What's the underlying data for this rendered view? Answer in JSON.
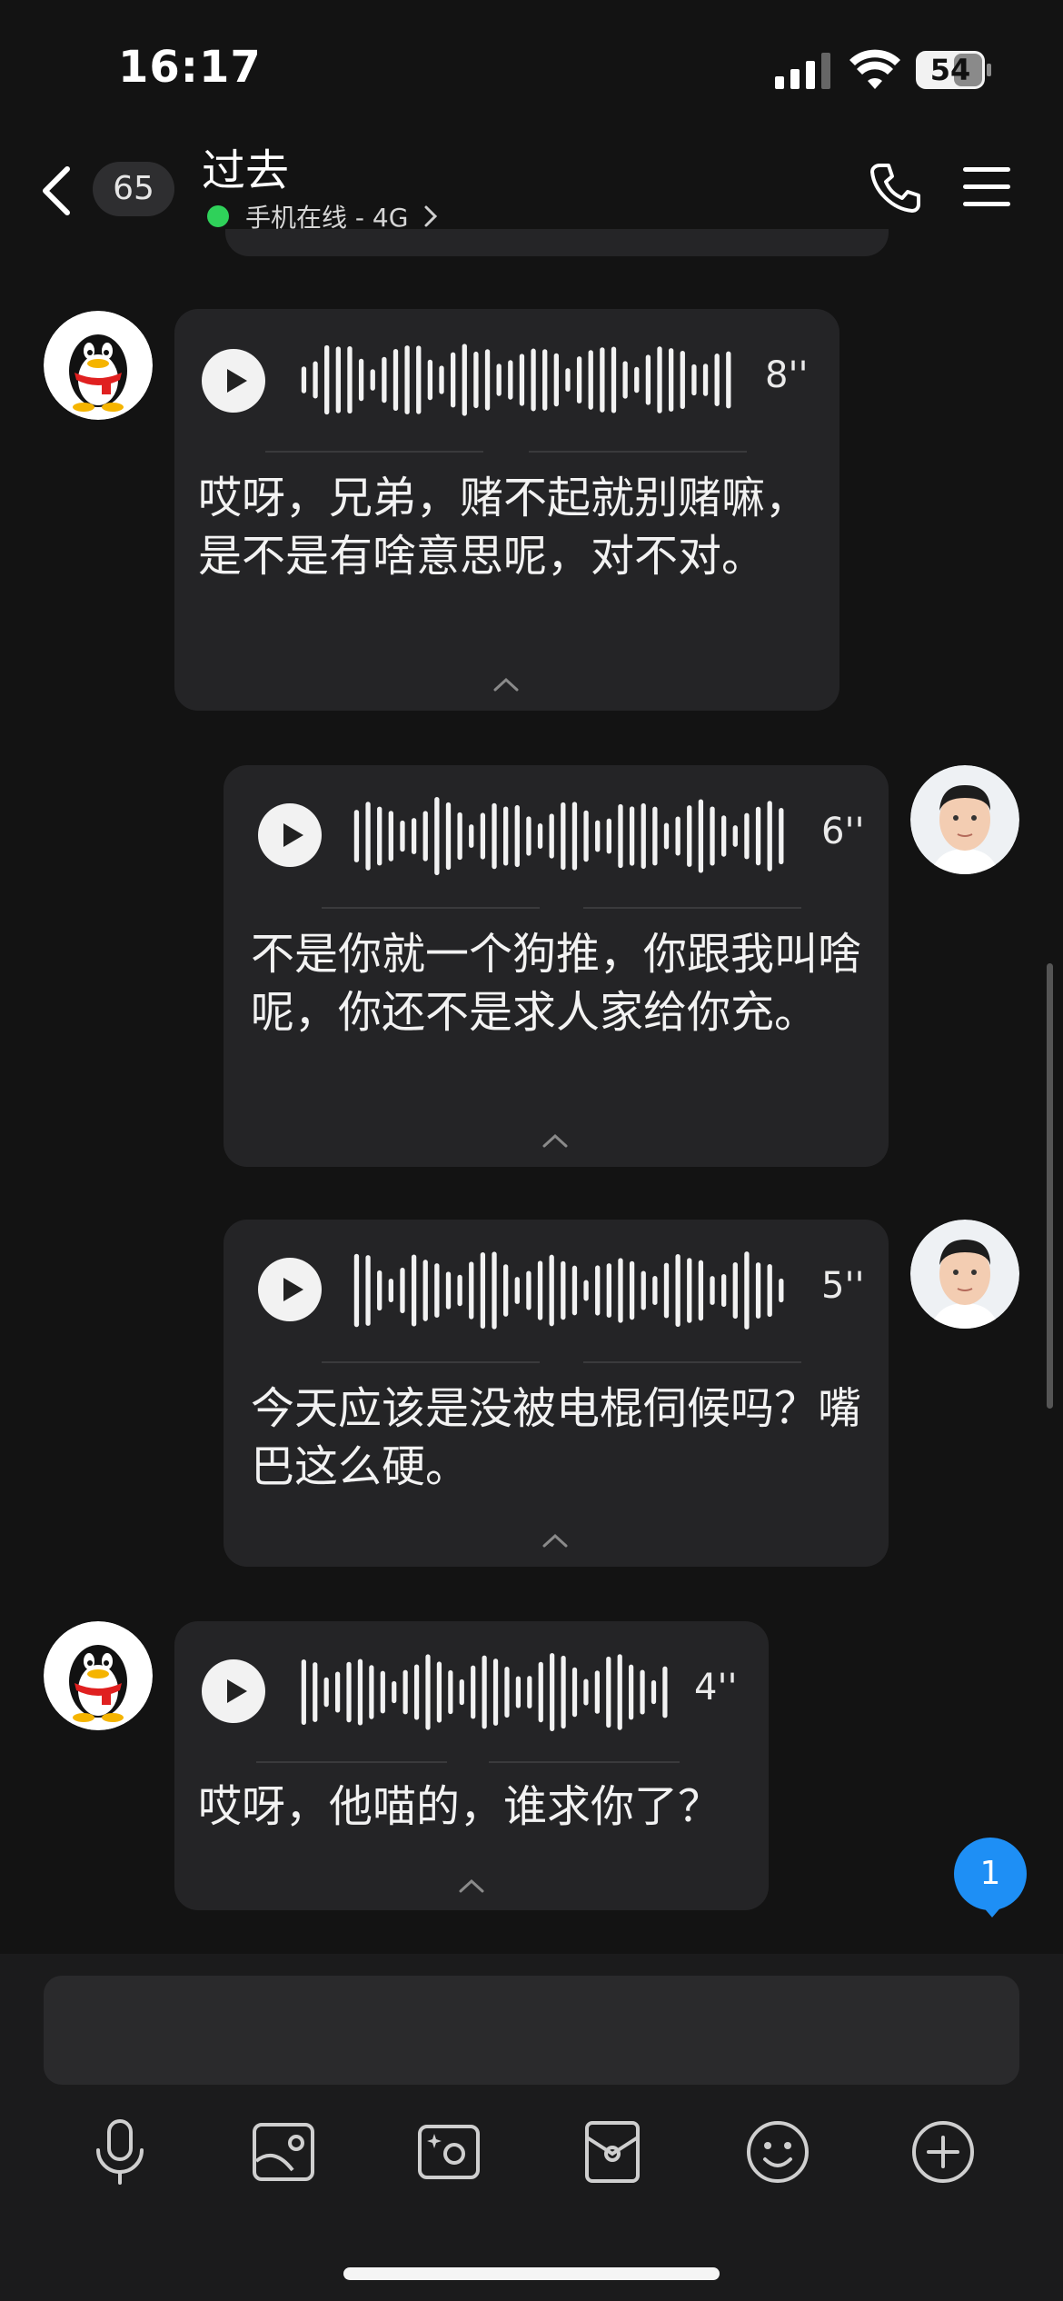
{
  "status_bar": {
    "time": "16:17",
    "battery": "54"
  },
  "header": {
    "unread_count": "65",
    "contact_name": "过去",
    "online_status": "手机在线 - 4G"
  },
  "messages": [
    {
      "sender": "contact",
      "duration": "8''",
      "transcript": "哎呀，兄弟，赌不起就别赌嘛，是不是有啥意思呢，对不对。"
    },
    {
      "sender": "me",
      "duration": "6''",
      "transcript": "不是你就一个狗推，你跟我叫啥呢，你还不是求人家给你充。"
    },
    {
      "sender": "me",
      "duration": "5''",
      "transcript": "今天应该是没被电棍伺候吗？嘴巴这么硬。"
    },
    {
      "sender": "contact",
      "duration": "4''",
      "transcript": "哎呀，他喵的，谁求你了？"
    }
  ],
  "new_message_badge": "1",
  "input": {
    "placeholder": ""
  },
  "toolbar": [
    "mic-icon",
    "image-icon",
    "camera-icon",
    "red-packet-icon",
    "emoji-icon",
    "plus-icon"
  ],
  "colors": {
    "background": "#131313",
    "bubble": "#242426",
    "online": "#2fd15a",
    "badge": "#1e8ff5"
  }
}
